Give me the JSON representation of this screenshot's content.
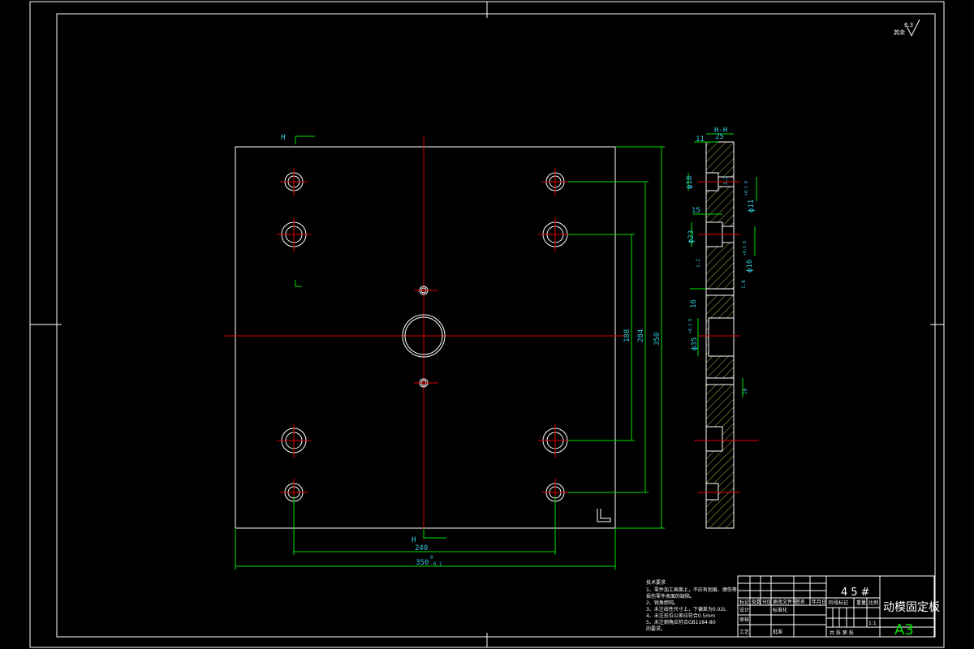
{
  "drawing": {
    "material": "45#",
    "title": "动模固定板",
    "sheet_size": "A3",
    "roughness_note": {
      "label": "其余",
      "value": "6.3"
    },
    "section_label_top": "H",
    "section_label_bottom": "H",
    "section_view_label": "H-H",
    "colors": {
      "outline": "#ffffff",
      "dimension": "#00e000",
      "centerline": "#e00000",
      "dim_text": "#33ccdd",
      "hatch": "#e0e060",
      "title_accent": "#00e000"
    }
  },
  "dimensions": {
    "width_240": "240",
    "width_350": "350",
    "width_350_tol_upper": "0",
    "width_350_tol_lower": "-0.1",
    "height_188": "188",
    "height_284": "284",
    "height_350": "350",
    "height_350_tol_upper": "0",
    "height_350_tol_lower": "-0.1",
    "thickness": "25",
    "step_11": "11",
    "step_15": "15",
    "step_16": "16",
    "dia_18": "ϕ18",
    "dia_11": "ϕ11",
    "dia_11_tol": "+0.1 0",
    "dia_23": "ϕ23",
    "dia_16": "ϕ16",
    "dia_16_tol": "+0.1 0",
    "dia_35": "ϕ35",
    "dia_35_tol": "+0.1 0",
    "rough_32": "3.2",
    "rough_12": "1.2",
    "rough_16": "1.6",
    "dim_10": "10"
  },
  "notes": {
    "heading": "技术要求",
    "lines": [
      "1、零件加工表面上，不应有划痕、擦伤等",
      "   损伤零件表面的缺陷。",
      "2、锐角倒钝。",
      "3、未注线性尺寸上，下偏差为0.02L",
      "4、未注形位公差应符合0.5mm",
      "5、未注倒角应符合GB1184-80",
      "   的要求。"
    ]
  },
  "title_block": {
    "row_labels": [
      "标记",
      "处数",
      "分区",
      "更改文件号",
      "签名",
      "年月日"
    ],
    "design": "设计",
    "standardize": "标准化",
    "review": "审核",
    "process": "工艺",
    "approve": "批准",
    "stage_mark": "阶段标记",
    "weight": "重量",
    "scale": "比例",
    "scale_value": "1:1",
    "sheets": "共  张 第  张"
  }
}
